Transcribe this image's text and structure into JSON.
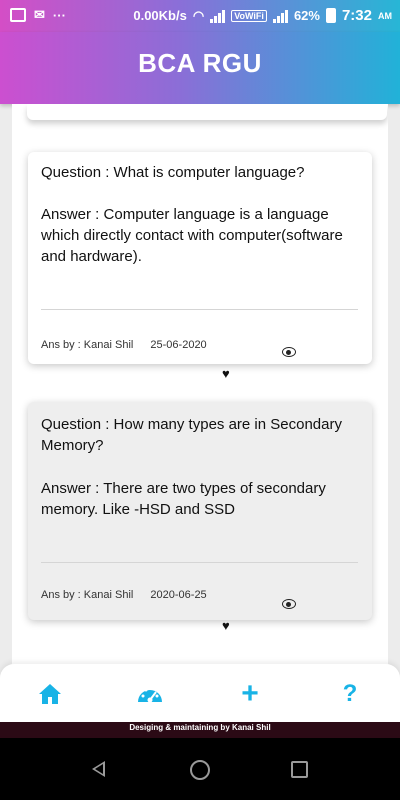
{
  "status_bar": {
    "speed": "0.00Kb/s",
    "volte": "VoWiFi",
    "battery": "62%",
    "time": "7:32",
    "ampm": "AM"
  },
  "app": {
    "title": "BCA RGU"
  },
  "posts": [
    {
      "question": "Question : What is computer language?",
      "answer": "Answer : Computer language is a language which directly contact with computer(software and hardware).",
      "author": "Ans by : Kanai Shil",
      "date": "25-06-2020"
    },
    {
      "question": "Question : How many types are in Secondary Memory?",
      "answer": "Answer : There are two types of secondary memory. Like -HSD and SSD",
      "author": "Ans by : Kanai Shil",
      "date": "2020-06-25"
    }
  ],
  "icons": {
    "nav": [
      "home-icon",
      "dashboard-icon",
      "add-icon",
      "help-icon"
    ],
    "post_actions": [
      "eye-icon",
      "heart-icon"
    ]
  },
  "nav": {
    "plus": "+",
    "help": "?"
  },
  "footer": {
    "text": "Desiging & maintaining by Kanai Shil"
  },
  "colors": {
    "accent": "#18b3e6",
    "gradient_start": "#cc4fd0",
    "gradient_end": "#21b2d8"
  }
}
